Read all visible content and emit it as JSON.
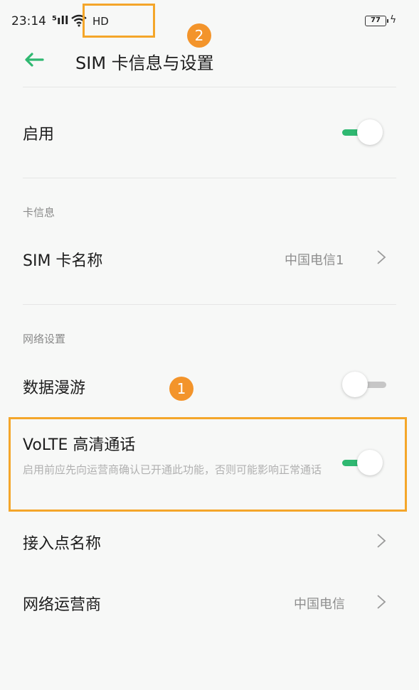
{
  "status_bar": {
    "time": "23:14",
    "signal": "⁵ıll",
    "network": "HD",
    "battery": "77"
  },
  "header": {
    "title": "SIM 卡信息与设置"
  },
  "rows": {
    "enable": {
      "label": "启用",
      "toggle_on": true
    },
    "section_card_info": "卡信息",
    "sim_name": {
      "label": "SIM 卡名称",
      "value": "中国电信1"
    },
    "section_network": "网络设置",
    "data_roaming": {
      "label": "数据漫游",
      "toggle_on": false
    },
    "volte": {
      "label": "VoLTE 高清通话",
      "description": "启用前应先向运营商确认已开通此功能，否则可能影响正常通话",
      "toggle_on": true
    },
    "apn": {
      "label": "接入点名称"
    },
    "carrier": {
      "label": "网络运营商",
      "value": "中国电信"
    }
  },
  "annotations": {
    "badge_1": "1",
    "badge_2": "2"
  },
  "colors": {
    "accent": "#2fb871",
    "annotation": "#f4a62a",
    "badge": "#f3942b"
  }
}
